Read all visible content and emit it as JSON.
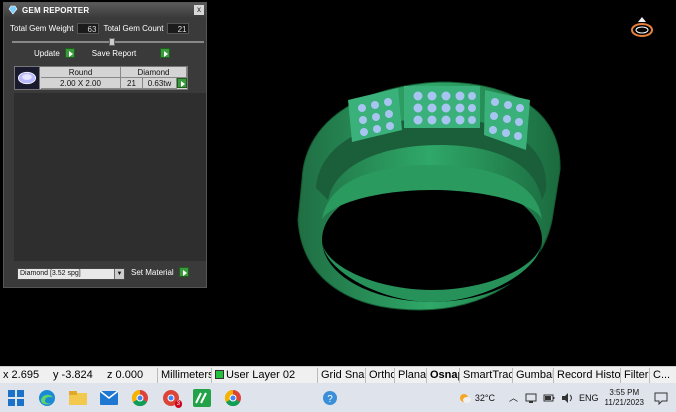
{
  "gem_reporter": {
    "title": "GEM REPORTER",
    "close": "x",
    "total_weight_label": "Total Gem Weight",
    "total_weight_value": "63",
    "total_count_label": "Total Gem Count",
    "total_count_value": "21",
    "update_label": "Update",
    "save_report_label": "Save Report",
    "slider_value": 0.5,
    "table": {
      "shape": "Round",
      "material": "Diamond",
      "size": "2.00 X 2.00",
      "count": "21",
      "weight": "0.63tw"
    },
    "material_select": "Diamond     [3.52 spg]",
    "set_material_label": "Set Material"
  },
  "statusbar": {
    "x": "x 2.695",
    "y": "y -3.824",
    "z": "z 0.000",
    "units": "Millimeters",
    "layer": "User Layer 02",
    "grid_snap": "Grid Snap",
    "ortho": "Ortho",
    "planar": "Planar",
    "osnap": "Osnap",
    "smarttrack": "SmartTrack",
    "gumball": "Gumball",
    "record_history": "Record History",
    "filter": "Filter",
    "more": "C..."
  },
  "taskbar": {
    "temperature": "32°C",
    "language": "ENG",
    "time": "3:55 PM",
    "date": "11/21/2023",
    "badge_count": "3"
  },
  "colors": {
    "ring": "#2e8b57",
    "gem": "#a8c4f0",
    "panel": "#3a3a3a",
    "button_green": "#3b9a3b"
  }
}
